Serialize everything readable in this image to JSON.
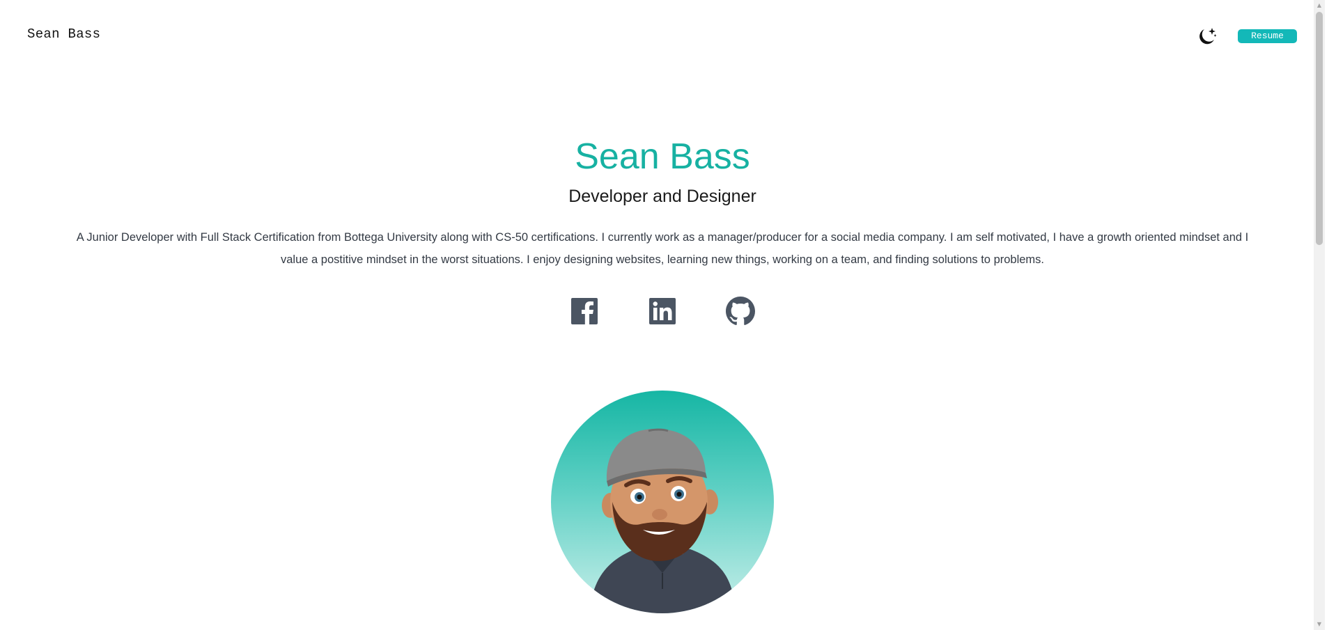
{
  "nav": {
    "brand": "Sean Bass",
    "theme_toggle_icon": "moon-stars-icon",
    "resume_label": "Resume"
  },
  "hero": {
    "name": "Sean Bass",
    "subtitle": "Developer and Designer",
    "bio": "A Junior Developer with Full Stack Certification from Bottega University along with CS-50 certifications. I currently work as a manager/producer for a social media company. I am self motivated, I have a growth oriented mindset and I value a postitive mindset in the worst situations. I enjoy designing websites, learning new things, working on a team, and finding solutions to problems."
  },
  "socials": [
    {
      "icon": "facebook-icon"
    },
    {
      "icon": "linkedin-icon"
    },
    {
      "icon": "github-icon"
    }
  ],
  "colors": {
    "accent": "#17b1a2",
    "button": "#13b8b8",
    "icon": "#4b5563",
    "text": "#333a44"
  }
}
